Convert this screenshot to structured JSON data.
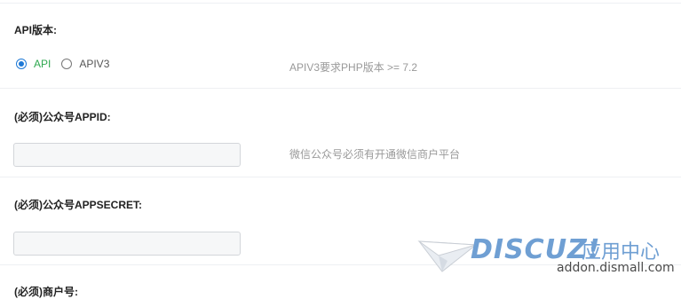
{
  "sections": {
    "api_version": {
      "label": "API版本:",
      "options": [
        "API",
        "APIV3"
      ],
      "selected": "API",
      "hint": "APIV3要求PHP版本 >= 7.2"
    },
    "appid": {
      "label": "(必须)公众号APPID:",
      "value": "",
      "hint": "微信公众号必须有开通微信商户平台"
    },
    "appsecret": {
      "label": "(必须)公众号APPSECRET:",
      "value": ""
    },
    "merchant": {
      "label": "(必须)商户号:"
    }
  },
  "watermark": {
    "brand": "DISCUZ!",
    "center": "应用中心",
    "url": "addon.dismall.com",
    "color": "#6f9fd3"
  },
  "colors": {
    "accent": "#1e79d6",
    "selected_text": "#2fa84f",
    "hint": "#999999",
    "divider": "#eef0f3"
  }
}
